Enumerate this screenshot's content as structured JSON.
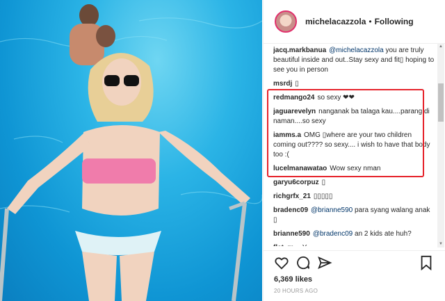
{
  "header": {
    "username": "michelacazzola",
    "separator": "•",
    "follow_status": "Following"
  },
  "comments": [
    {
      "user": "jacq.markbanua",
      "mention": "@michelacazzola",
      "text": " you are truly beautiful inside and out..Stay sexy and fit▯ hoping to see you in person"
    },
    {
      "user": "msrdj",
      "mention": "",
      "text": "▯"
    },
    {
      "user": "redmango24",
      "mention": "",
      "text": "so sexy ❤❤"
    },
    {
      "user": "jaguarevelyn",
      "mention": "",
      "text": "nanganak ba talaga kau....parang di naman....so sexy"
    },
    {
      "user": "iamms.a",
      "mention": "",
      "text": "OMG ▯where are your two children coming out???? so sexy.... i wish to have that body too :("
    },
    {
      "user": "lucelmanawatao",
      "mention": "",
      "text": "Wow sexy nman"
    },
    {
      "user": "garyu6corpuz",
      "mention": "",
      "text": "▯"
    },
    {
      "user": "richgrfx_21",
      "mention": "",
      "text": "▯▯▯▯▯"
    },
    {
      "user": "bradenc09",
      "mention": "@brianne590",
      "text": " para syang walang anak ▯"
    },
    {
      "user": "brianne590",
      "mention": "@bradenc09",
      "text": " an 2 kids ate huh?"
    },
    {
      "user": "flat_m...",
      "mention": "",
      "text": "Y..."
    }
  ],
  "actions": {
    "like_icon": "heart-icon",
    "comment_icon": "comment-icon",
    "share_icon": "share-icon",
    "save_icon": "bookmark-icon"
  },
  "likes": "6,369 likes",
  "time_ago": "20 HOURS AGO",
  "colors": {
    "highlight": "#e6222a",
    "mention": "#003569",
    "pool": "#1aa6df"
  }
}
